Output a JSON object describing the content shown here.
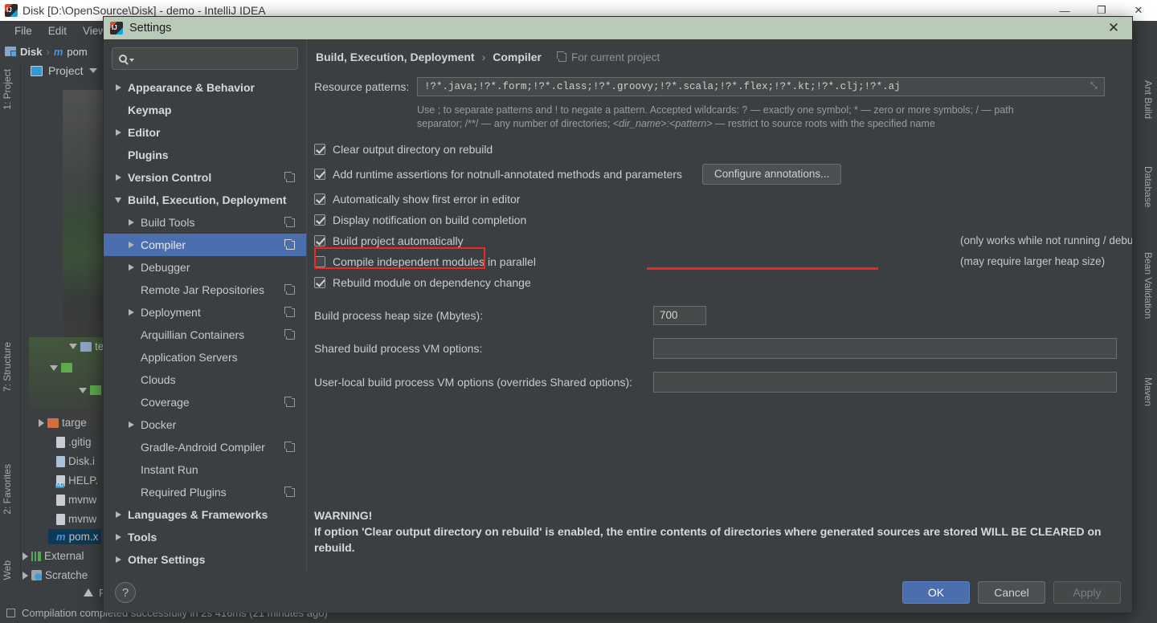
{
  "ide": {
    "window_title": "Disk [D:\\OpenSource\\Disk] - demo - IntelliJ IDEA",
    "window_controls": {
      "minimize": "—",
      "maximize": "❐",
      "close": "✕"
    },
    "menu": [
      "File",
      "Edit",
      "View"
    ],
    "breadcrumb": {
      "root": "Disk",
      "separator": "›",
      "module_marker": "m",
      "file": "pom"
    },
    "project_panel": {
      "title": "Project"
    },
    "left_rail": [
      "1: Project",
      "7: Structure",
      "2: Favorites",
      "Web"
    ],
    "right_rail": [
      "Ant Build",
      "Database",
      "Bean Validation",
      "Maven"
    ],
    "tree": [
      {
        "label": "tes",
        "icon": "folder-icon",
        "arrow": "down",
        "indent": 86
      },
      {
        "label": "targe",
        "icon": "folder-orange-icon",
        "arrow": "right",
        "indent": 52
      },
      {
        "label": ".gitig",
        "icon": "file-icon",
        "arrow": "none",
        "indent": 72
      },
      {
        "label": "Disk.i",
        "icon": "file-icon",
        "arrow": "none",
        "indent": 72
      },
      {
        "label": "HELP.",
        "icon": "markdown-icon",
        "arrow": "none",
        "indent": 72
      },
      {
        "label": "mvnw",
        "icon": "file-icon",
        "arrow": "none",
        "indent": 72
      },
      {
        "label": "mvnw",
        "icon": "file-icon",
        "arrow": "none",
        "indent": 72
      },
      {
        "label": "pom.x",
        "icon": "maven-icon",
        "arrow": "none",
        "indent": 72,
        "selected": true
      },
      {
        "label": "External",
        "icon": "libraries-icon",
        "arrow": "right",
        "indent": 30
      },
      {
        "label": "Scratche",
        "icon": "scratches-icon",
        "arrow": "right",
        "indent": 30
      }
    ],
    "problems_label": "Problems",
    "status_text": "Compilation completed successfully in 2s 416ms (21 minutes ago)"
  },
  "dialog": {
    "title": "Settings",
    "close_label": "✕",
    "search": {
      "placeholder": "",
      "value": ""
    },
    "nav": [
      {
        "label": "Appearance & Behavior",
        "arrow": "right",
        "bold": true,
        "copy": false,
        "indent": 0
      },
      {
        "label": "Keymap",
        "arrow": "none",
        "bold": true,
        "copy": false,
        "indent": 0
      },
      {
        "label": "Editor",
        "arrow": "right",
        "bold": true,
        "copy": false,
        "indent": 0
      },
      {
        "label": "Plugins",
        "arrow": "none",
        "bold": true,
        "copy": false,
        "indent": 0
      },
      {
        "label": "Version Control",
        "arrow": "right",
        "bold": true,
        "copy": true,
        "indent": 0
      },
      {
        "label": "Build, Execution, Deployment",
        "arrow": "down",
        "bold": true,
        "copy": false,
        "indent": 0
      },
      {
        "label": "Build Tools",
        "arrow": "right",
        "bold": false,
        "copy": true,
        "indent": 1
      },
      {
        "label": "Compiler",
        "arrow": "right",
        "bold": false,
        "copy": true,
        "indent": 1,
        "selected": true
      },
      {
        "label": "Debugger",
        "arrow": "right",
        "bold": false,
        "copy": false,
        "indent": 1
      },
      {
        "label": "Remote Jar Repositories",
        "arrow": "none",
        "bold": false,
        "copy": true,
        "indent": 1
      },
      {
        "label": "Deployment",
        "arrow": "right",
        "bold": false,
        "copy": true,
        "indent": 1
      },
      {
        "label": "Arquillian Containers",
        "arrow": "none",
        "bold": false,
        "copy": true,
        "indent": 1
      },
      {
        "label": "Application Servers",
        "arrow": "none",
        "bold": false,
        "copy": false,
        "indent": 1
      },
      {
        "label": "Clouds",
        "arrow": "none",
        "bold": false,
        "copy": false,
        "indent": 1
      },
      {
        "label": "Coverage",
        "arrow": "none",
        "bold": false,
        "copy": true,
        "indent": 1
      },
      {
        "label": "Docker",
        "arrow": "right",
        "bold": false,
        "copy": false,
        "indent": 1
      },
      {
        "label": "Gradle-Android Compiler",
        "arrow": "none",
        "bold": false,
        "copy": true,
        "indent": 1
      },
      {
        "label": "Instant Run",
        "arrow": "none",
        "bold": false,
        "copy": false,
        "indent": 1
      },
      {
        "label": "Required Plugins",
        "arrow": "none",
        "bold": false,
        "copy": true,
        "indent": 1
      },
      {
        "label": "Languages & Frameworks",
        "arrow": "right",
        "bold": true,
        "copy": false,
        "indent": 0
      },
      {
        "label": "Tools",
        "arrow": "right",
        "bold": true,
        "copy": false,
        "indent": 0
      },
      {
        "label": "Other Settings",
        "arrow": "right",
        "bold": true,
        "copy": false,
        "indent": 0
      }
    ],
    "content": {
      "breadcrumb_section": "Build, Execution, Deployment",
      "breadcrumb_sep": "›",
      "breadcrumb_page": "Compiler",
      "scope_label": "For current project",
      "resource_patterns_label": "Resource patterns:",
      "resource_patterns_value": "!?*.java;!?*.form;!?*.class;!?*.groovy;!?*.scala;!?*.flex;!?*.kt;!?*.clj;!?*.aj",
      "resource_patterns_expand": "⤡",
      "hint_line1": "Use ; to separate patterns and ! to negate a pattern. Accepted wildcards: ? — exactly one symbol; * — zero or more symbols; / — path",
      "hint_line2_a": "separator; /**/ — any number of directories; ",
      "hint_line2_i": "<dir_name>:<pattern>",
      "hint_line2_b": " — restrict to source roots with the specified name",
      "checkboxes": [
        {
          "label": "Clear output directory on rebuild",
          "checked": true
        },
        {
          "label": "Add runtime assertions for notnull-annotated methods and parameters",
          "checked": true
        },
        {
          "label": "Automatically show first error in editor",
          "checked": true
        },
        {
          "label": "Display notification on build completion",
          "checked": true
        },
        {
          "label": "Build project automatically",
          "checked": true,
          "highlighted": true
        },
        {
          "label": "Compile independent modules in parallel",
          "checked": false
        },
        {
          "label": "Rebuild module on dependency change",
          "checked": true
        }
      ],
      "configure_annotations_button": "Configure annotations...",
      "note_build_auto": "(only works while not running / debugging)",
      "note_parallel": "(may require larger heap size)",
      "heap_label": "Build process heap size (Mbytes):",
      "heap_value": "700",
      "shared_vm_label": "Shared build process VM options:",
      "shared_vm_value": "",
      "user_vm_label": "User-local build process VM options (overrides Shared options):",
      "user_vm_value": "",
      "warning_title": "WARNING!",
      "warning_body": "If option 'Clear output directory on rebuild' is enabled, the entire contents of directories where generated sources are stored WILL BE CLEARED on rebuild."
    },
    "footer": {
      "help_label": "?",
      "ok_label": "OK",
      "cancel_label": "Cancel",
      "apply_label": "Apply"
    }
  },
  "colors": {
    "accent_blue": "#4b6eaf",
    "highlight_red": "#ef2626",
    "dialog_title_bg": "#b8cbb8",
    "panel_bg": "#3c3f41"
  }
}
